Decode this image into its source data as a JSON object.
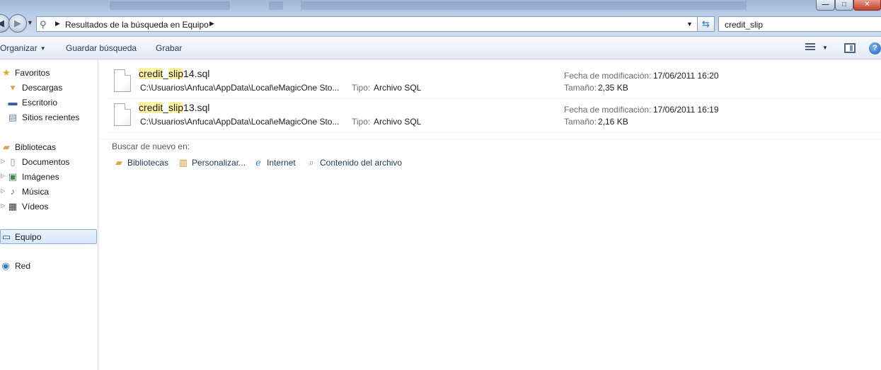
{
  "window": {
    "taskbar_ghost_labels": [
      "Español (España, internacional)"
    ],
    "controls": {
      "minimize": "—",
      "maximize": "□",
      "close": "✕"
    }
  },
  "address_bar": {
    "breadcrumb": "Resultados de la búsqueda en Equipo",
    "search_value": "credit_slip"
  },
  "commands": {
    "organize": "Organizar",
    "save_search": "Guardar búsqueda",
    "burn": "Grabar"
  },
  "navigation": {
    "favorites": {
      "label": "Favoritos",
      "items": [
        "Descargas",
        "Escritorio",
        "Sitios recientes"
      ]
    },
    "libraries": {
      "label": "Bibliotecas",
      "items": [
        "Documentos",
        "Imágenes",
        "Música",
        "Vídeos"
      ]
    },
    "computer": "Equipo",
    "network": "Red"
  },
  "results": [
    {
      "name_match_1": "credit",
      "name_sep": "_",
      "name_match_2": "slip",
      "name_rest": "14.sql",
      "path": "C:\\Usuarios\\Anfuca\\AppData\\Local\\eMagicOne Sto...",
      "type_label": "Tipo:",
      "type_value": "Archivo SQL",
      "modified_label": "Fecha de modificación:",
      "modified_value": "17/06/2011 16:20",
      "size_label": "Tamaño:",
      "size_value": "2,35 KB"
    },
    {
      "name_match_1": "credit",
      "name_sep": "_",
      "name_match_2": "slip",
      "name_rest": "13.sql",
      "path": "C:\\Usuarios\\Anfuca\\AppData\\Local\\eMagicOne Sto...",
      "type_label": "Tipo:",
      "type_value": "Archivo SQL",
      "modified_label": "Fecha de modificación:",
      "modified_value": "17/06/2011 16:19",
      "size_label": "Tamaño:",
      "size_value": "2,16 KB"
    }
  ],
  "search_again": {
    "title": "Buscar de nuevo en:",
    "items": [
      "Bibliotecas",
      "Personalizar...",
      "Internet",
      "Contenido del archivo"
    ]
  },
  "icons": {
    "favorites": "star-icon",
    "downloads": "downloads-folder-icon",
    "desktop": "desktop-icon",
    "recent": "recent-places-icon",
    "libraries": "libraries-icon",
    "documents": "documents-icon",
    "pictures": "pictures-icon",
    "music": "music-icon",
    "videos": "videos-icon",
    "computer": "computer-icon",
    "network": "network-icon",
    "internet": "internet-explorer-icon",
    "file_contents": "file-contents-icon"
  },
  "colors": {
    "highlight": "#fff3a8",
    "selection_border": "#84acdd",
    "link_text": "#1e395b"
  }
}
